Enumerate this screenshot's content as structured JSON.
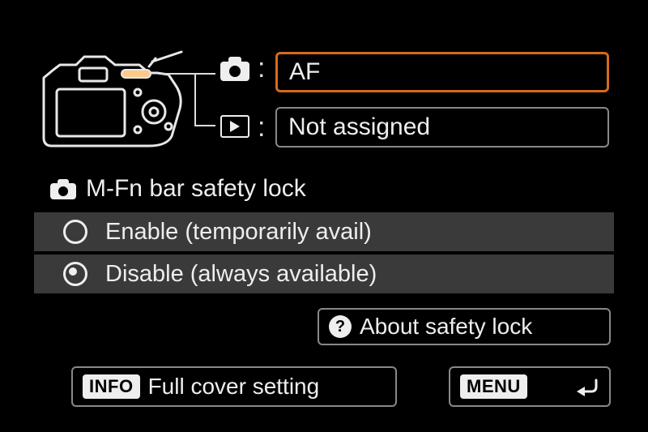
{
  "assignments": {
    "shooting": {
      "value": "AF"
    },
    "playback": {
      "value": "Not assigned"
    }
  },
  "safety_lock": {
    "title": "M-Fn bar safety lock",
    "options": [
      {
        "label": "Enable (temporarily avail)",
        "selected": false
      },
      {
        "label": "Disable (always available)",
        "selected": true
      }
    ]
  },
  "about_button": {
    "label": "About safety lock"
  },
  "bottom": {
    "info_key": "INFO",
    "info_label": "Full cover setting",
    "menu_key": "MENU"
  },
  "icons": {
    "camera": "camera-icon",
    "playback": "playback-icon",
    "help": "?",
    "return": "return-icon"
  },
  "colors": {
    "highlight": "#d56a1c"
  }
}
